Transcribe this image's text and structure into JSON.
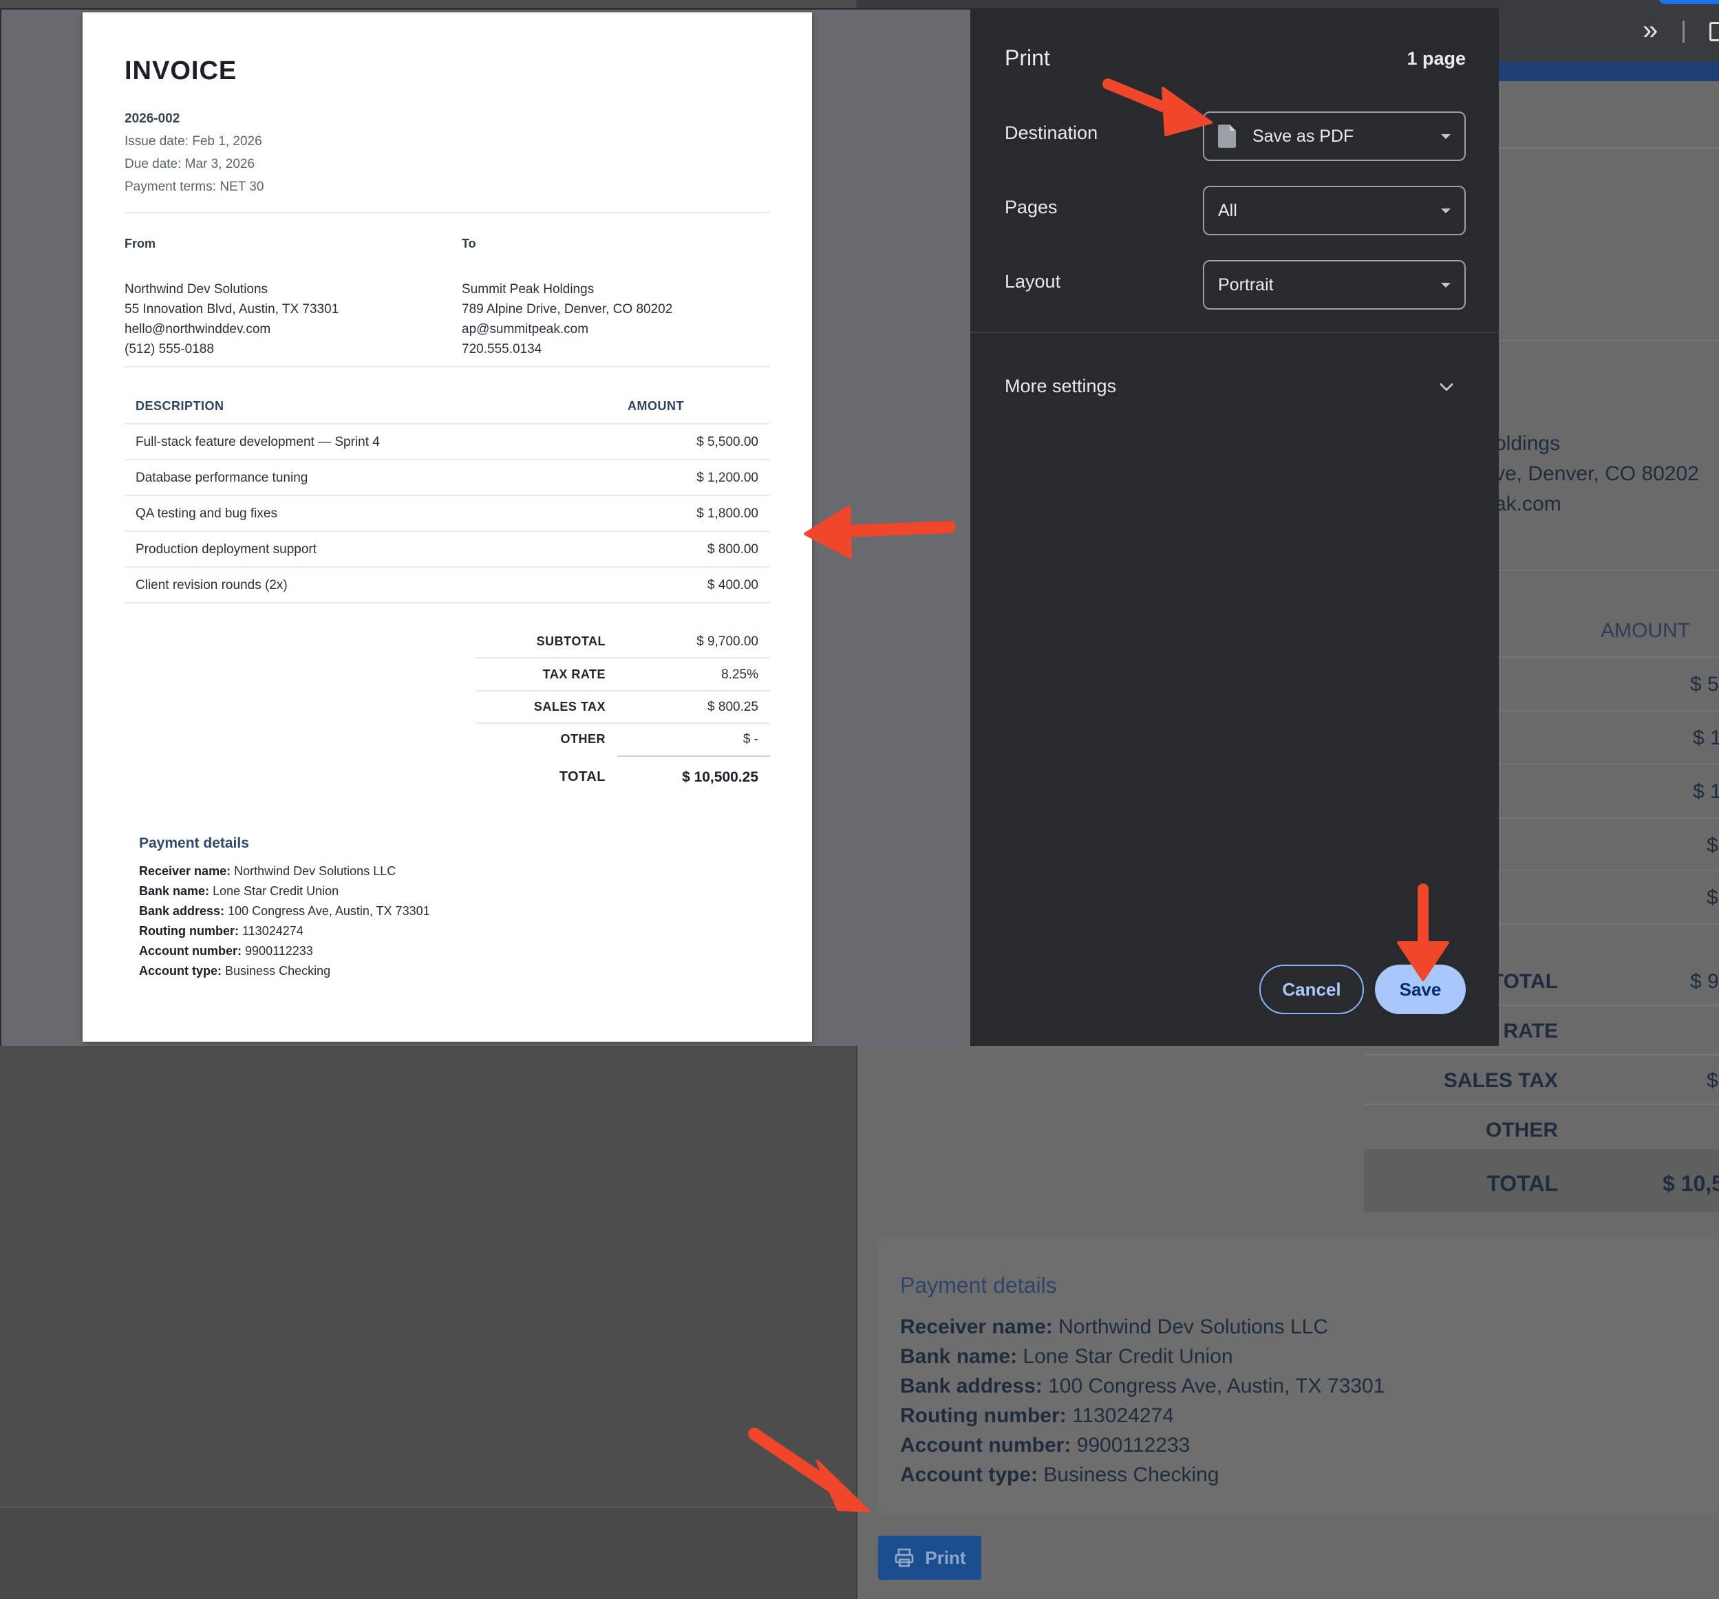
{
  "background": {
    "addr_lines": [
      "oldings",
      "ve, Denver, CO 80202",
      "ak.com"
    ],
    "amount_header": "AMOUNT",
    "amount_cells": [
      "$ 5",
      "$ 1",
      "$ 1",
      "$",
      "$"
    ],
    "summary": [
      {
        "label": "TOTAL",
        "value": "$ 9"
      },
      {
        "label": "RATE",
        "value": ""
      },
      {
        "label": "SALES TAX",
        "value": "$"
      },
      {
        "label": "OTHER",
        "value": ""
      },
      {
        "label": "TOTAL",
        "value": "$ 10,5"
      }
    ],
    "payment": {
      "title": "Payment details",
      "lines": [
        {
          "label": "Receiver name:",
          "value": "Northwind Dev Solutions LLC"
        },
        {
          "label": "Bank name:",
          "value": "Lone Star Credit Union"
        },
        {
          "label": "Bank address:",
          "value": "100 Congress Ave, Austin, TX 73301"
        },
        {
          "label": "Routing number:",
          "value": "113024274"
        },
        {
          "label": "Account number:",
          "value": "9900112233"
        },
        {
          "label": "Account type:",
          "value": "Business Checking"
        }
      ]
    },
    "print_button": {
      "label": "Print",
      "icon": "printer-icon"
    }
  },
  "preview": {
    "title": "INVOICE",
    "number": "2026-002",
    "issue_date": "Issue date: Feb 1, 2026",
    "due_date": "Due date: Mar 3, 2026",
    "terms": "Payment terms: NET 30",
    "from": {
      "heading": "From",
      "lines": [
        "Northwind Dev Solutions",
        "55 Innovation Blvd, Austin, TX 73301",
        "hello@northwinddev.com",
        "(512) 555-0188"
      ]
    },
    "to": {
      "heading": "To",
      "lines": [
        "Summit Peak Holdings",
        "789 Alpine Drive, Denver, CO 80202",
        "ap@summitpeak.com",
        "720.555.0134"
      ]
    },
    "table": {
      "headers": [
        "DESCRIPTION",
        "AMOUNT"
      ],
      "rows": [
        {
          "description": "Full-stack feature development — Sprint 4",
          "amount": "$ 5,500.00"
        },
        {
          "description": "Database performance tuning",
          "amount": "$ 1,200.00"
        },
        {
          "description": "QA testing and bug fixes",
          "amount": "$ 1,800.00"
        },
        {
          "description": "Production deployment support",
          "amount": "$ 800.00"
        },
        {
          "description": "Client revision rounds (2x)",
          "amount": "$ 400.00"
        }
      ]
    },
    "summary": [
      {
        "label": "SUBTOTAL",
        "value": "$ 9,700.00"
      },
      {
        "label": "TAX RATE",
        "value": "8.25%"
      },
      {
        "label": "SALES TAX",
        "value": "$ 800.25"
      },
      {
        "label": "OTHER",
        "value": "$ -"
      },
      {
        "label": "TOTAL",
        "value": "$ 10,500.25"
      }
    ],
    "payment": {
      "title": "Payment details",
      "lines": [
        {
          "label": "Receiver name:",
          "value": "Northwind Dev Solutions LLC"
        },
        {
          "label": "Bank name:",
          "value": "Lone Star Credit Union"
        },
        {
          "label": "Bank address:",
          "value": "100 Congress Ave, Austin, TX 73301"
        },
        {
          "label": "Routing number:",
          "value": "113024274"
        },
        {
          "label": "Account number:",
          "value": "9900112233"
        },
        {
          "label": "Account type:",
          "value": "Business Checking"
        }
      ]
    }
  },
  "settings": {
    "title": "Print",
    "page_count": "1 page",
    "destination": {
      "label": "Destination",
      "value": "Save as PDF",
      "icon": "document-icon"
    },
    "pages": {
      "label": "Pages",
      "value": "All"
    },
    "layout": {
      "label": "Layout",
      "value": "Portrait"
    },
    "more_settings": "More settings",
    "cancel": "Cancel",
    "save": "Save"
  },
  "colors": {
    "annotation_arrow": "#f0462a",
    "save_button": "#a8c7fa",
    "dialog_bg": "#292a2d",
    "print_button": "#1b4e8f"
  }
}
